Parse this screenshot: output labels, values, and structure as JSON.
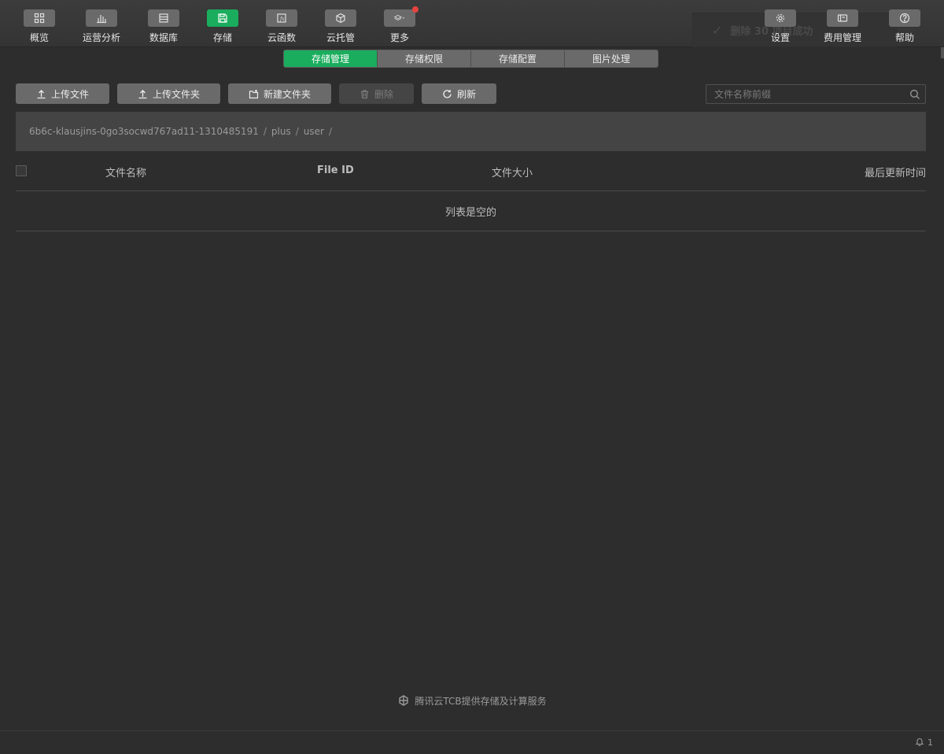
{
  "toolbar": {
    "left_tools": [
      {
        "label": "概览",
        "icon": "grid-icon"
      },
      {
        "label": "运营分析",
        "icon": "bar-chart-icon"
      },
      {
        "label": "数据库",
        "icon": "database-icon"
      },
      {
        "label": "存储",
        "icon": "save-icon"
      },
      {
        "label": "云函数",
        "icon": "function-icon"
      },
      {
        "label": "云托管",
        "icon": "cube-icon"
      },
      {
        "label": "更多",
        "icon": "layers-icon"
      }
    ],
    "right_tools": [
      {
        "label": "设置",
        "icon": "gear-icon"
      },
      {
        "label": "费用管理",
        "icon": "billing-icon"
      },
      {
        "label": "帮助",
        "icon": "help-icon"
      }
    ],
    "active_tool": "存储",
    "background_toast": "删除 30 项目成功"
  },
  "tabs": [
    "存储管理",
    "存储权限",
    "存储配置",
    "图片处理"
  ],
  "active_tab": "存储管理",
  "actions": {
    "upload_file": "上传文件",
    "upload_folder": "上传文件夹",
    "new_folder": "新建文件夹",
    "delete": "删除",
    "refresh": "刷新"
  },
  "search": {
    "placeholder": "文件名称前缀",
    "value": ""
  },
  "breadcrumb": [
    "6b6c-klausjins-0go3socwd767ad11-1310485191",
    "plus",
    "user"
  ],
  "table": {
    "columns": [
      "文件名称",
      "File ID",
      "文件大小",
      "最后更新时间"
    ],
    "empty_text": "列表是空的"
  },
  "footer": {
    "powered_by": "腾讯云TCB提供存储及计算服务"
  },
  "statusbar": {
    "notification_count": "1"
  },
  "colors": {
    "accent": "#1aad5d",
    "badge": "#e64340",
    "background": "#2d2d2d"
  }
}
